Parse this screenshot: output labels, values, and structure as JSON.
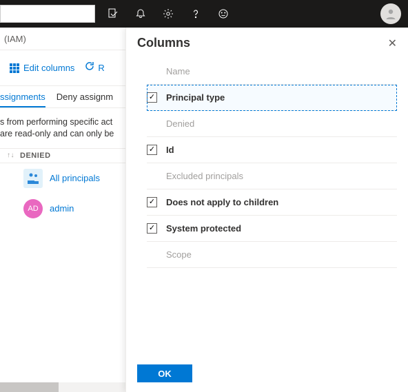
{
  "breadcrumb": "(IAM)",
  "toolbar": {
    "edit_columns": "Edit columns",
    "refresh_fragment": "R"
  },
  "tabs": {
    "role": "ssignments",
    "deny": "Deny assignm"
  },
  "description": {
    "line1": "s from performing specific act",
    "line2": "are read-only and can only be"
  },
  "table": {
    "denied_header": "DENIED",
    "rows": [
      {
        "icon": "people",
        "label": "All principals"
      },
      {
        "icon": "admin",
        "badge": "AD",
        "label": "admin"
      }
    ]
  },
  "panel": {
    "title": "Columns",
    "ok": "OK",
    "columns": [
      {
        "label": "Name",
        "checked": false,
        "selectable": false
      },
      {
        "label": "Principal type",
        "checked": true,
        "selectable": true,
        "selected": true
      },
      {
        "label": "Denied",
        "checked": false,
        "selectable": false
      },
      {
        "label": "Id",
        "checked": true,
        "selectable": true
      },
      {
        "label": "Excluded principals",
        "checked": false,
        "selectable": false
      },
      {
        "label": "Does not apply to children",
        "checked": true,
        "selectable": true
      },
      {
        "label": "System protected",
        "checked": true,
        "selectable": true
      },
      {
        "label": "Scope",
        "checked": false,
        "selectable": false
      }
    ]
  }
}
